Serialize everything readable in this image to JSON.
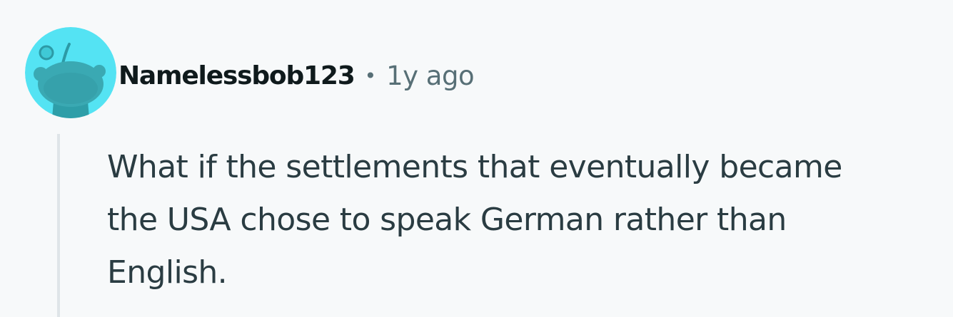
{
  "comment": {
    "avatar_icon": "reddit-snoo-avatar-icon",
    "avatar_color": "#54e3f3",
    "username": "Namelessbob123",
    "separator": "•",
    "timestamp": "1y ago",
    "text_lines": [
      "What if the settlements that eventually became",
      "the USA chose to speak German rather than",
      "English."
    ]
  }
}
